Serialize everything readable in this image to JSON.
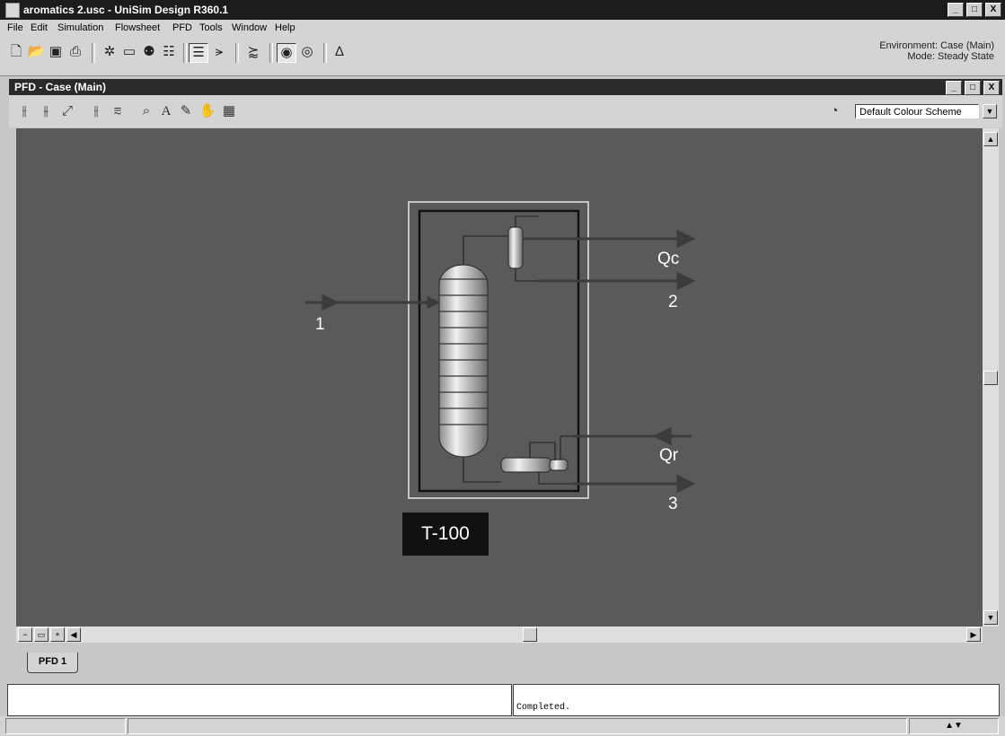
{
  "window": {
    "title": "aromatics 2.usc - UniSim Design R360.1",
    "buttons": [
      "_",
      "□",
      "X"
    ]
  },
  "menu": [
    "File",
    "Edit",
    "Simulation",
    "Flowsheet",
    "PFD",
    "Tools",
    "Window",
    "Help"
  ],
  "environment": {
    "line1": "Environment: Case (Main)",
    "line2": "Mode: Steady State"
  },
  "pfd_window": {
    "title": "PFD - Case (Main)",
    "colour_scheme": "Default Colour Scheme",
    "tab_label": "PFD 1"
  },
  "flowsheet": {
    "unit_label": "T-100",
    "streams": {
      "feed": "1",
      "condenser_duty": "Qc",
      "distillate": "2",
      "reboiler_duty": "Qr",
      "bottoms": "3"
    }
  },
  "status": {
    "message": "Completed."
  },
  "icons": {
    "app": "document-icon",
    "toolbar": [
      "new-file-icon",
      "open-folder-icon",
      "save-icon",
      "print-icon",
      "stream-icon",
      "object-palette-icon",
      "binoculars-icon",
      "workbook-icon",
      "pfd-icon",
      "mixer-icon",
      "connect-icon",
      "eye-icon",
      "eye2-icon",
      "flask-icon"
    ]
  },
  "colors": {
    "canvas": "#5a5a5a",
    "title_bar": "#1c1c1c",
    "stream": "#3c3c3c"
  }
}
